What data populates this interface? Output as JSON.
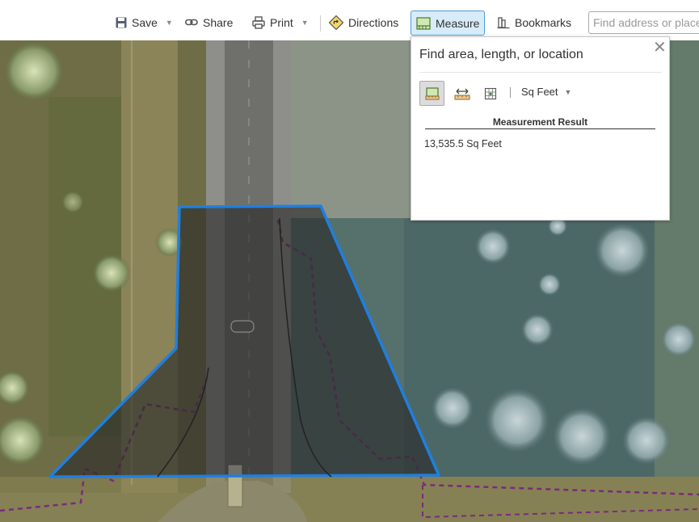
{
  "toolbar": {
    "save_label": "Save",
    "share_label": "Share",
    "print_label": "Print",
    "directions_label": "Directions",
    "measure_label": "Measure",
    "bookmarks_label": "Bookmarks",
    "search_placeholder": "Find address or place"
  },
  "measure_panel": {
    "title": "Find area, length, or location",
    "tools": [
      {
        "name": "area-tool",
        "active": true
      },
      {
        "name": "distance-tool",
        "active": false
      },
      {
        "name": "location-tool",
        "active": false
      }
    ],
    "units_selected": "Sq Feet",
    "result_header": "Measurement Result",
    "result_value": "13,535.5 Sq Feet"
  },
  "colors": {
    "accent": "#1f7fe0",
    "active_button_bg": "#d7ecf8",
    "parcel_line": "#7b2a7b",
    "polygon_fill": "rgba(40,40,40,0.62)"
  },
  "icons": {
    "save": "floppy-disk-icon",
    "share": "link-icon",
    "print": "printer-icon",
    "directions": "directions-sign-icon",
    "measure": "ruler-icon",
    "bookmarks": "bookmark-icon",
    "close": "close-icon"
  }
}
